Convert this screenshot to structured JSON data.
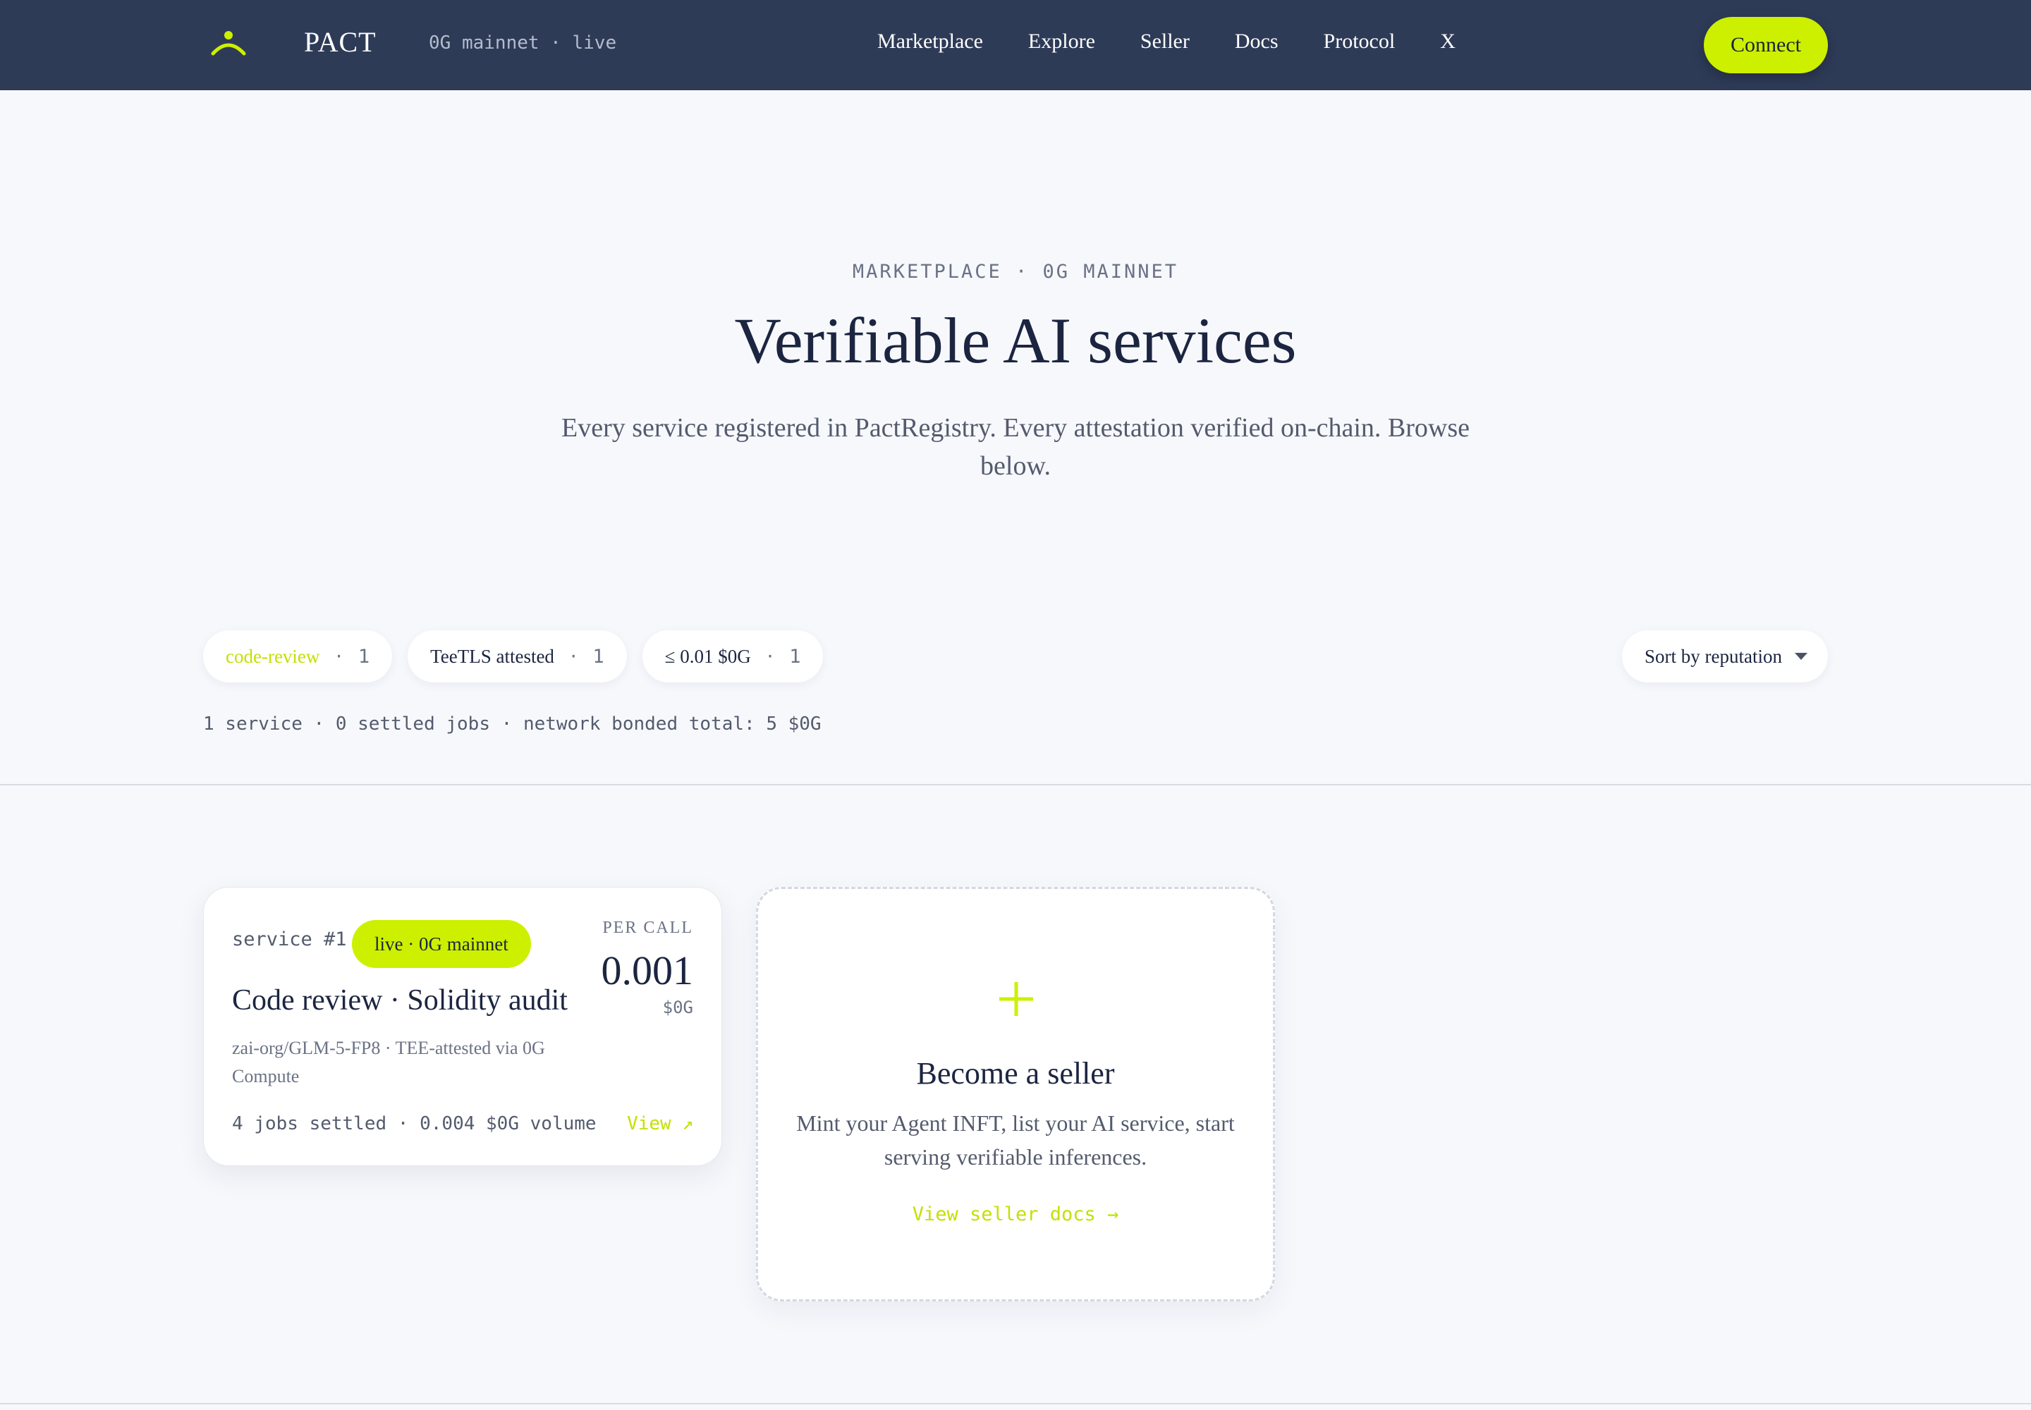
{
  "nav": {
    "brand": "PACT",
    "network": "0G mainnet · live",
    "links": [
      "Marketplace",
      "Explore",
      "Seller",
      "Docs",
      "Protocol",
      "X"
    ],
    "connect_label": "Connect"
  },
  "hero": {
    "eyebrow": "MARKETPLACE · 0G MAINNET",
    "title": "Verifiable AI services",
    "subtitle": "Every service registered in PactRegistry. Every attestation verified on-chain. Browse below."
  },
  "filters": [
    {
      "label": "code-review",
      "sep": "·",
      "count": "1",
      "active": true
    },
    {
      "label": "TeeTLS attested",
      "sep": "·",
      "count": "1",
      "active": false
    },
    {
      "label": "≤ 0.01 $0G",
      "sep": "·",
      "count": "1",
      "active": false
    }
  ],
  "sort": {
    "label": "Sort by reputation"
  },
  "stats": "1 service · 0 settled jobs · network bonded total: 5 $0G",
  "services": [
    {
      "id": "service #1",
      "badge": "live · 0G mainnet",
      "per_call_label": "PER CALL",
      "price": "0.001",
      "unit": "$0G",
      "title": "Code review · Solidity audit",
      "description": "zai-org/GLM-5-FP8 · TEE-attested via 0G Compute",
      "stats": "4 jobs settled · 0.004 $0G volume",
      "view_label": "View ↗"
    }
  ],
  "seller_card": {
    "title": "Become a seller",
    "description": "Mint your Agent INFT, list your AI service, start serving verifiable inferences.",
    "link": "View seller docs →"
  },
  "colors": {
    "accent": "#cdf000",
    "accent_text": "#c4e000",
    "nav_bg": "#2e3b57",
    "page_bg": "#f7f8fc"
  }
}
